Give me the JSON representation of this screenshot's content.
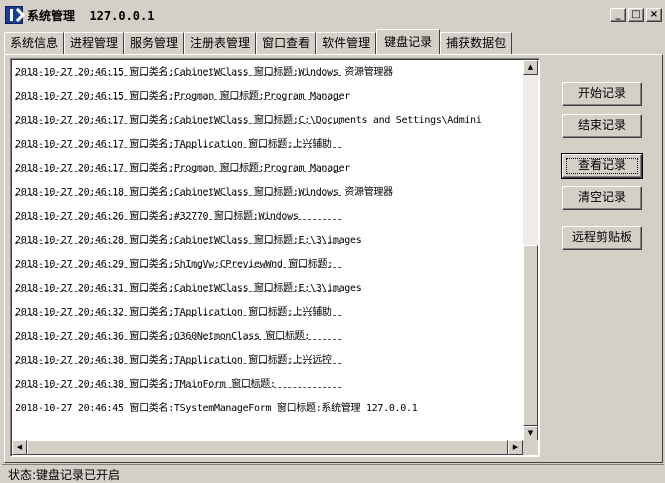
{
  "window": {
    "title": "系统管理  127.0.0.1",
    "min_glyph": "_",
    "max_glyph": "□",
    "close_glyph": "×"
  },
  "tabs": [
    {
      "label": "系统信息"
    },
    {
      "label": "进程管理"
    },
    {
      "label": "服务管理"
    },
    {
      "label": "注册表管理"
    },
    {
      "label": "窗口查看"
    },
    {
      "label": "软件管理"
    },
    {
      "label": "键盘记录",
      "active": true
    },
    {
      "label": "捕获数据包"
    }
  ],
  "log": {
    "entries": [
      "2018-10-27 20:46:15 窗口类名:CabinetWClass 窗口标题:Windows 资源管理器",
      "2018-10-27 20:46:15 窗口类名:Progman 窗口标题:Program Manager",
      "2018-10-27 20:46:17 窗口类名:CabinetWClass 窗口标题:C:\\Documents and Settings\\Admini",
      "2018-10-27 20:46:17 窗口类名:TApplication 窗口标题:上兴辅助",
      "2018-10-27 20:46:17 窗口类名:Progman 窗口标题:Program Manager",
      "2018-10-27 20:46:18 窗口类名:CabinetWClass 窗口标题:Windows 资源管理器",
      "2018-10-27 20:46:26 窗口类名:#32770 窗口标题:Windows",
      "2018-10-27 20:46:28 窗口类名:CabinetWClass 窗口标题:E:\\3\\images",
      "2018-10-27 20:46:29 窗口类名:ShImgVw:CPreviewWnd 窗口标题:",
      "2018-10-27 20:46:31 窗口类名:CabinetWClass 窗口标题:E:\\3\\images",
      "2018-10-27 20:46:32 窗口类名:TApplication 窗口标题:上兴辅助",
      "2018-10-27 20:46:36 窗口类名:Q360NetmonClass 窗口标题:",
      "2018-10-27 20:46:38 窗口类名:TApplication 窗口标题:上兴远控",
      "2018-10-27 20:46:38 窗口类名:TMainForm 窗口标题:",
      "2018-10-27 20:46:45 窗口类名:TSystemManageForm 窗口标题:系统管理 127.0.0.1"
    ],
    "separator": "------------------------------------------------------------------"
  },
  "buttons": {
    "start": "开始记录",
    "stop": "结束记录",
    "view": "查看记录",
    "clear": "清空记录",
    "clipboard": "远程剪贴板"
  },
  "status": {
    "text": "状态:键盘记录已开启"
  },
  "colors": {
    "face": "#d4d0c8",
    "list_bg": "#ffffff"
  }
}
